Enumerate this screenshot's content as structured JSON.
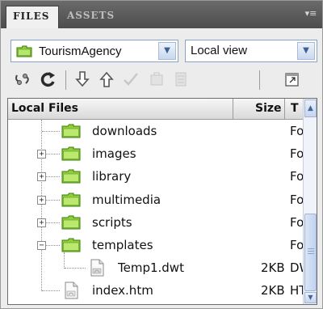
{
  "tabs": [
    {
      "label": "FILES",
      "active": true
    },
    {
      "label": "ASSETS",
      "active": false
    }
  ],
  "site_selector": {
    "value": "TourismAgency"
  },
  "view_selector": {
    "value": "Local view"
  },
  "toolbar": [
    {
      "name": "connect-icon",
      "enabled": true
    },
    {
      "name": "refresh-icon",
      "enabled": true
    },
    {
      "name": "get-files-icon",
      "enabled": true
    },
    {
      "name": "put-files-icon",
      "enabled": true
    },
    {
      "name": "check-out-icon",
      "enabled": false
    },
    {
      "name": "check-in-icon",
      "enabled": false
    },
    {
      "name": "synchronize-icon",
      "enabled": false
    },
    {
      "name": "expand-icon",
      "enabled": true
    }
  ],
  "columns": {
    "name": "Local Files",
    "size": "Size",
    "type": "T"
  },
  "files": [
    {
      "name": "downloads",
      "size": "",
      "type": "Fo",
      "kind": "folder",
      "expander": ""
    },
    {
      "name": "images",
      "size": "",
      "type": "Fo",
      "kind": "folder",
      "expander": "+"
    },
    {
      "name": "library",
      "size": "",
      "type": "Fo",
      "kind": "folder",
      "expander": "+"
    },
    {
      "name": "multimedia",
      "size": "",
      "type": "Fo",
      "kind": "folder",
      "expander": "+"
    },
    {
      "name": "scripts",
      "size": "",
      "type": "Fo",
      "kind": "folder",
      "expander": "+"
    },
    {
      "name": "templates",
      "size": "",
      "type": "Fo",
      "kind": "folder",
      "expander": "−"
    },
    {
      "name": "Temp1.dwt",
      "size": "2KB",
      "type": "DW",
      "kind": "dwt",
      "expander": ""
    },
    {
      "name": "index.htm",
      "size": "2KB",
      "type": "HT",
      "kind": "htm",
      "expander": ""
    }
  ],
  "colors": {
    "folder": "#8fcf3a",
    "selection_border": "#8aa2c4",
    "header_bg": "#5a5a5a"
  }
}
